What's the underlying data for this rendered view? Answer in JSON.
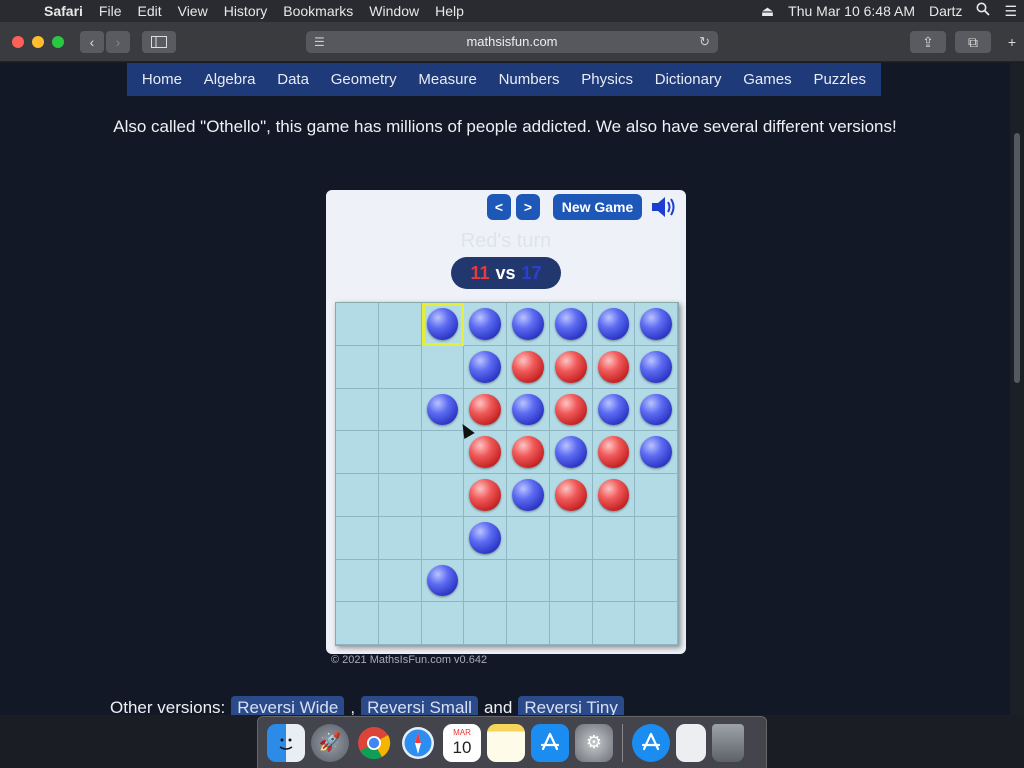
{
  "menubar": {
    "app_name": "Safari",
    "menus": [
      "File",
      "Edit",
      "View",
      "History",
      "Bookmarks",
      "Window",
      "Help"
    ],
    "datetime": "Thu Mar 10  6:48 AM",
    "user": "Dartz"
  },
  "browser": {
    "url": "mathsisfun.com"
  },
  "nav": {
    "items": [
      "Home",
      "Algebra",
      "Data",
      "Geometry",
      "Measure",
      "Numbers",
      "Physics",
      "Dictionary",
      "Games",
      "Puzzles"
    ]
  },
  "intro_text": "Also called \"Othello\", this game has millions of people addicted. We also have several different versions!",
  "game": {
    "prev_label": "<",
    "next_label": ">",
    "new_game_label": "New Game",
    "turn_text": "Red's turn",
    "score": {
      "red": "11",
      "vs": "vs",
      "blue": "17"
    },
    "board": [
      [
        ".",
        ".",
        "B",
        "B",
        "B",
        "B",
        "B",
        "B"
      ],
      [
        ".",
        ".",
        ".",
        "B",
        "R",
        "R",
        "R",
        "B"
      ],
      [
        ".",
        ".",
        "B",
        "R",
        "B",
        "R",
        "B",
        "B"
      ],
      [
        ".",
        ".",
        ".",
        "R",
        "R",
        "B",
        "R",
        "B"
      ],
      [
        ".",
        ".",
        ".",
        "R",
        "B",
        "R",
        "R",
        "."
      ],
      [
        ".",
        ".",
        ".",
        "B",
        ".",
        ".",
        ".",
        "."
      ],
      [
        ".",
        ".",
        "B",
        ".",
        ".",
        ".",
        ".",
        "."
      ],
      [
        ".",
        ".",
        ".",
        ".",
        ".",
        ".",
        ".",
        "."
      ]
    ],
    "highlight": {
      "row": 0,
      "col": 2
    },
    "colors": {
      "red_disc": "#e03a3a",
      "blue_disc": "#3a46e0",
      "board": "#b3dbe6"
    }
  },
  "copyright": "© 2021 MathsIsFun.com  v0.642",
  "other_versions": {
    "label": "Other versions:",
    "links": [
      "Reversi Wide",
      "Reversi Small",
      "Reversi Tiny"
    ],
    "sep_comma": ",",
    "sep_and": "and"
  },
  "dock": {
    "apps": [
      "finder-icon",
      "launchpad-icon",
      "chrome-icon",
      "safari-icon",
      "calendar-icon",
      "notes-icon",
      "app-store-icon",
      "system-preferences-icon",
      "app-store-downloads-icon",
      "file-icon",
      "trash-icon"
    ],
    "calendar_month": "MAR",
    "calendar_day": "10"
  }
}
